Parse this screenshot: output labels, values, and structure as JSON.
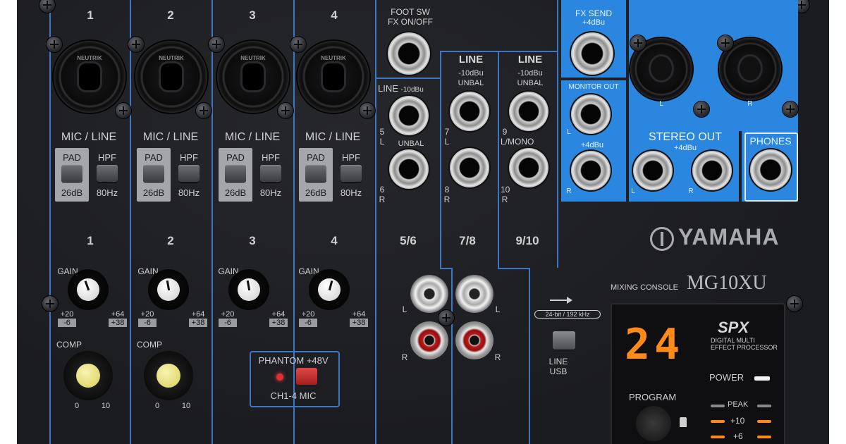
{
  "mixer": {
    "brand": "YAMAHA",
    "model_caption": "MIXING CONSOLE",
    "model": "MG10XU",
    "top_numbers": [
      "1",
      "2",
      "3",
      "4"
    ],
    "xlr_brand": "NEUTRIK",
    "mic_line": "MIC / LINE",
    "pad": "PAD",
    "pad_value": "26dB",
    "hpf": "HPF",
    "hpf_value": "80Hz",
    "channel_numbers": [
      "1",
      "2",
      "3",
      "4",
      "5/6",
      "7/8",
      "9/10"
    ],
    "gain": "GAIN",
    "gain_min": "+20",
    "gain_min2": "-6",
    "gain_max": "+64",
    "gain_max2": "+38",
    "comp": "COMP",
    "comp_min": "0",
    "comp_max": "10",
    "phantom_title": "PHANTOM +48V",
    "phantom_sub": "CH1-4 MIC",
    "foot_sw": "FOOT SW",
    "fx_onoff": "FX ON/OFF",
    "line": "LINE",
    "line_level": "-10dBu",
    "unbal": "UNBAL",
    "jack_labels": {
      "j5": "5",
      "j5s": "L",
      "j6": "6",
      "j6s": "R",
      "j7": "7",
      "j7s": "L",
      "j8": "8",
      "j8s": "R",
      "j9": "9",
      "j9s": "L/MONO",
      "j10": "10",
      "j10s": "R"
    },
    "fx_send": "FX SEND",
    "plus4": "+4dBu",
    "monitor_out": "MONITOR OUT",
    "stereo_out": "STEREO OUT",
    "phones": "PHONES",
    "lr": {
      "l": "L",
      "r": "R"
    },
    "usb_spec": "24-bit / 192 kHz",
    "line_usb_line": "LINE",
    "line_usb_usb": "USB",
    "spx_logo": "SPX",
    "spx_sub1": "DIGITAL MULTI",
    "spx_sub2": "EFFECT PROCESSOR",
    "program_number": "24",
    "program": "PROGRAM",
    "power": "POWER",
    "peak": "PEAK",
    "meter_10": "+10",
    "meter_6": "+6"
  },
  "colors": {
    "accent_blue": "#2a86de",
    "led_orange": "#ff8a1a",
    "led_red": "#e23030"
  }
}
